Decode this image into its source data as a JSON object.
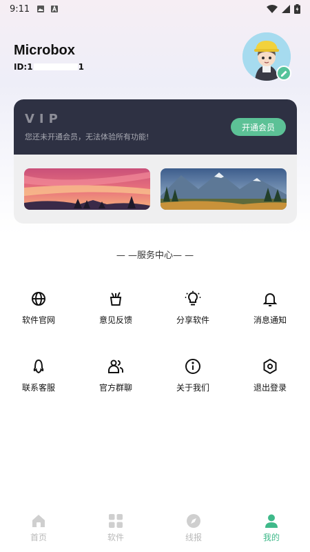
{
  "status_bar": {
    "time": "9:11"
  },
  "profile": {
    "name": "Microbox",
    "id_prefix": "ID:1",
    "id_suffix": "1"
  },
  "vip": {
    "title": "VIP",
    "description": "您还未开通会员，无法体验所有功能!",
    "button_label": "开通会员"
  },
  "services": {
    "title": "— —服务中心— —",
    "items": [
      {
        "label": "软件官网",
        "icon": "globe-icon"
      },
      {
        "label": "意见反馈",
        "icon": "feedback-icon"
      },
      {
        "label": "分享软件",
        "icon": "lightbulb-icon"
      },
      {
        "label": "消息通知",
        "icon": "bell-icon"
      },
      {
        "label": "联系客服",
        "icon": "qq-icon"
      },
      {
        "label": "官方群聊",
        "icon": "group-icon"
      },
      {
        "label": "关于我们",
        "icon": "info-icon"
      },
      {
        "label": "退出登录",
        "icon": "hexagon-icon"
      }
    ]
  },
  "bottom_nav": {
    "items": [
      {
        "label": "首页",
        "icon": "home-icon",
        "active": false
      },
      {
        "label": "软件",
        "icon": "apps-grid-icon",
        "active": false
      },
      {
        "label": "线报",
        "icon": "compass-icon",
        "active": false
      },
      {
        "label": "我的",
        "icon": "person-icon",
        "active": true
      }
    ]
  },
  "colors": {
    "accent": "#3fb98a",
    "vip_dark": "#2e3143",
    "vip_button": "#5cc196"
  }
}
